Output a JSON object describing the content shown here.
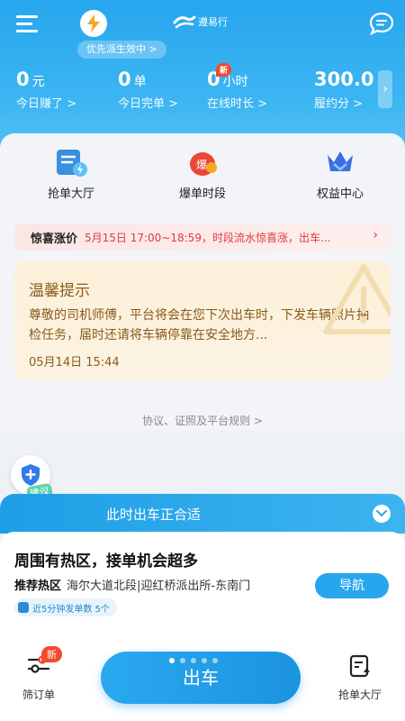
{
  "header": {
    "priority_status": "优先派生效中 >",
    "app_name": "遵易行"
  },
  "stats": [
    {
      "value": "0",
      "unit": "元",
      "label": "今日赚了 >"
    },
    {
      "value": "0",
      "unit": "单",
      "label": "今日完单 >"
    },
    {
      "value": "0",
      "unit": "小时",
      "label": "在线时长 >",
      "badge": "新"
    },
    {
      "value": "300.0",
      "unit": "",
      "label": "履约分 >"
    }
  ],
  "quick_actions": [
    {
      "label": "抢单大厅",
      "icon": "order-hall-icon"
    },
    {
      "label": "爆单时段",
      "icon": "hot-period-icon"
    },
    {
      "label": "权益中心",
      "icon": "crown-icon"
    }
  ],
  "surge": {
    "label": "惊喜涨价",
    "text": "5月15日 17:00~18:59，时段流水惊喜涨，出车..."
  },
  "notice": {
    "title": "温馨提示",
    "body": "尊敬的司机师傅，平台将会在您下次出车时，下发车辆照片抽检任务，届时还请将车辆停靠在安全地方...",
    "date": "05月14日 15:44"
  },
  "rules_link": "协议、证照及平台规则 >",
  "assistant": {
    "tag": "建议"
  },
  "sheet": {
    "header": "此时出车正合适",
    "title": "周围有热区，接单机会超多",
    "hot_label": "推荐热区",
    "hot_value": "海尔大道北段|迎红桥派出所-东南门",
    "nav_label": "导航",
    "recent_info": "近5分钟发单数 5个"
  },
  "bottom_nav": {
    "filter_label": "筛订单",
    "filter_badge": "新",
    "depart_label": "出车",
    "grab_label": "抢单大厅"
  },
  "colors": {
    "primary": "#27a6ee",
    "accent_red": "#e23a3a",
    "notice_brown": "#8a5a1c"
  }
}
